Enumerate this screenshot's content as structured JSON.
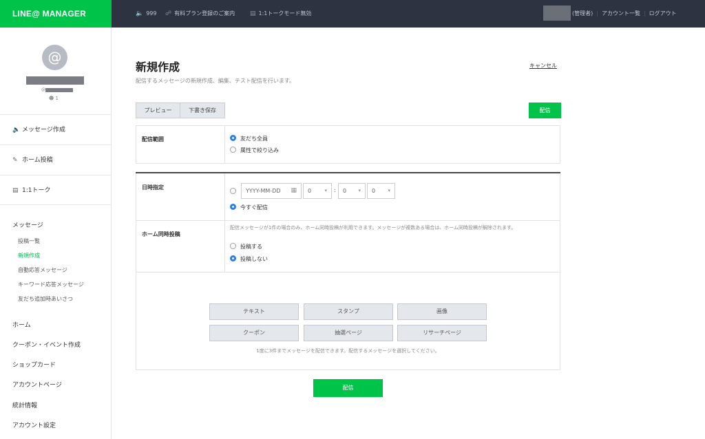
{
  "topbar": {
    "logo": "LINE@ MANAGER",
    "messages_count": "999",
    "plan_notice": "有料プラン登録のご案内",
    "talk_mode": "1:1トークモード無効",
    "admin_label": "(管理者)",
    "account_list": "アカウント一覧",
    "logout": "ログアウト"
  },
  "sidebar": {
    "avatar_glyph": "@",
    "account_id_prefix": "@",
    "friends_count": "1",
    "nav": [
      {
        "label": "メッセージ作成",
        "icon": "speaker-icon"
      },
      {
        "label": "ホーム投稿",
        "icon": "edit-icon"
      },
      {
        "label": "1:1トーク",
        "icon": "chat-icon"
      }
    ],
    "message_section": "メッセージ",
    "message_sub": [
      "投稿一覧",
      "新規作成",
      "自動応答メッセージ",
      "キーワード応答メッセージ",
      "友だち追加時あいさつ"
    ],
    "main_items": [
      "ホーム",
      "クーポン・イベント作成",
      "ショップカード",
      "アカウントページ",
      "統計情報",
      "アカウント設定"
    ]
  },
  "main": {
    "title": "新規作成",
    "subtitle": "配信するメッセージの新規作成、編集、テスト配信を行います。",
    "cancel": "キャンセル",
    "preview": "プレビュー",
    "save_draft": "下書き保存",
    "send": "配信",
    "scope_label": "配信範囲",
    "scope_all": "友だち全員",
    "scope_attr": "属性で絞り込み",
    "date_label": "日時指定",
    "date_placeholder": "YYYY-MM-DD",
    "hour_value": "0",
    "minute_value": "0",
    "second_value": "0",
    "time_sep": ":",
    "send_now": "今すぐ配信",
    "home_post_label": "ホーム同時投稿",
    "home_post_note": "配信メッセージが1件の場合のみ、ホーム同時投稿が利用できます。メッセージが複数ある場合は、ホーム同時投稿が解除されます。",
    "post_yes": "投稿する",
    "post_no": "投稿しない",
    "content_buttons": [
      "テキスト",
      "スタンプ",
      "画像",
      "クーポン",
      "抽選ページ",
      "リサーチページ"
    ],
    "limit_note": "1度に3件までメッセージを配信できます。配信するメッセージを選択してください。",
    "send_bottom": "配信"
  },
  "colors": {
    "brand_green": "#00c34a",
    "topbar_bg": "#2e3341",
    "radio_blue": "#2b7de9"
  }
}
